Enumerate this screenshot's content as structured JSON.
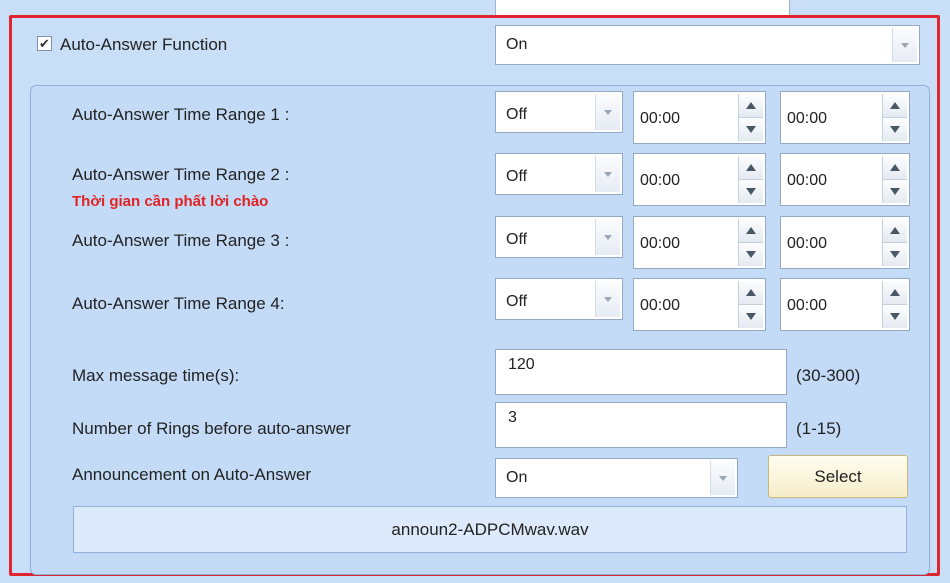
{
  "auto_answer": {
    "label": "Auto-Answer Function",
    "checked": true,
    "value": "On"
  },
  "time_ranges": [
    {
      "label": "Auto-Answer Time Range 1 :",
      "state": "Off",
      "start": "00:00",
      "end": "00:00"
    },
    {
      "label": "Auto-Answer Time Range 2 :",
      "state": "Off",
      "start": "00:00",
      "end": "00:00"
    },
    {
      "label": "Auto-Answer Time Range 3 :",
      "state": "Off",
      "start": "00:00",
      "end": "00:00"
    },
    {
      "label": "Auto-Answer Time Range 4:",
      "state": "Off",
      "start": "00:00",
      "end": "00:00"
    }
  ],
  "annotation": "Thời gian cần phất lời chào",
  "max_message": {
    "label": "Max message time(s):",
    "value": "120",
    "range": "(30-300)"
  },
  "rings": {
    "label": "Number of Rings before auto-answer",
    "value": "3",
    "range": "(1-15)"
  },
  "announcement": {
    "label": "Announcement on Auto-Answer",
    "value": "On",
    "select_label": "Select",
    "file": "announ2-ADPCMwav.wav"
  },
  "colors": {
    "highlight_frame": "#e0252f",
    "annotation_text": "#e22222",
    "panel_bg": "#c9def7"
  }
}
